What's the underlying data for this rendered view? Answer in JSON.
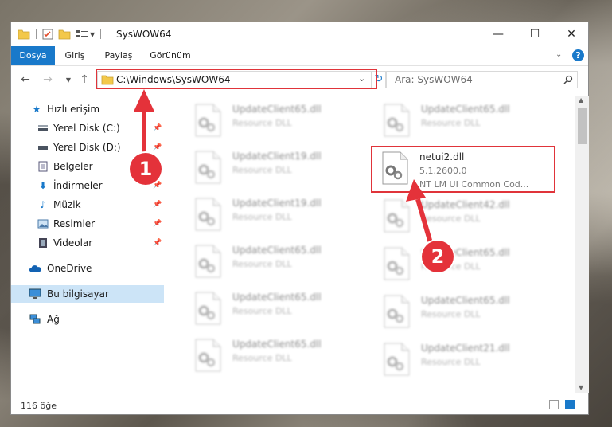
{
  "window": {
    "title": "SysWOW64",
    "controls": {
      "minimize": "—",
      "maximize": "☐",
      "close": "✕"
    }
  },
  "ribbon": {
    "tabs": [
      "Dosya",
      "Giriş",
      "Paylaş",
      "Görünüm"
    ]
  },
  "nav": {
    "address": "C:\\Windows\\SysWOW64",
    "search_placeholder": "Ara: SysWOW64"
  },
  "sidebar": {
    "items": [
      {
        "label": "Hızlı erişim",
        "icon": "star-icon",
        "pinned": false
      },
      {
        "label": "Yerel Disk (C:)",
        "icon": "drive-icon",
        "pinned": true
      },
      {
        "label": "Yerel Disk (D:)",
        "icon": "drive-icon",
        "pinned": true
      },
      {
        "label": "Belgeler",
        "icon": "documents-icon",
        "pinned": true
      },
      {
        "label": "İndirmeler",
        "icon": "download-icon",
        "pinned": true
      },
      {
        "label": "Müzik",
        "icon": "music-icon",
        "pinned": true
      },
      {
        "label": "Resimler",
        "icon": "pictures-icon",
        "pinned": true
      },
      {
        "label": "Videolar",
        "icon": "videos-icon",
        "pinned": true
      },
      {
        "label": "OneDrive",
        "icon": "cloud-icon",
        "pinned": false
      },
      {
        "label": "Bu bilgisayar",
        "icon": "computer-icon",
        "pinned": false
      },
      {
        "label": "Ağ",
        "icon": "network-icon",
        "pinned": false
      }
    ]
  },
  "files": {
    "left": [
      {
        "name": "UpdateClient65.dll",
        "desc": "Resource DLL"
      },
      {
        "name": "UpdateClient19.dll",
        "desc": "Resource DLL"
      },
      {
        "name": "UpdateClient19.dll",
        "desc": "Resource DLL"
      },
      {
        "name": "UpdateClient65.dll",
        "desc": "Resource DLL"
      },
      {
        "name": "UpdateClient65.dll",
        "desc": "Resource DLL"
      },
      {
        "name": "UpdateClient65.dll",
        "desc": "Resource DLL"
      }
    ],
    "right": [
      {
        "name": "UpdateClient65.dll",
        "desc": "Resource DLL"
      },
      {
        "name": "UpdateClient42.dll",
        "desc": "Resource DLL"
      },
      {
        "name": "UpdateClient65.dll",
        "desc": "Resource DLL"
      },
      {
        "name": "UpdateClient65.dll",
        "desc": "Resource DLL"
      },
      {
        "name": "UpdateClient21.dll",
        "desc": "Resource DLL"
      }
    ],
    "highlighted": {
      "name": "netui2.dll",
      "version": "5.1.2600.0",
      "desc": "NT LM UI Common Cod..."
    }
  },
  "status": {
    "count": "116 öğe"
  },
  "callouts": {
    "one": "1",
    "two": "2"
  },
  "colors": {
    "accent": "#1979ca",
    "highlight": "#e0343a"
  }
}
